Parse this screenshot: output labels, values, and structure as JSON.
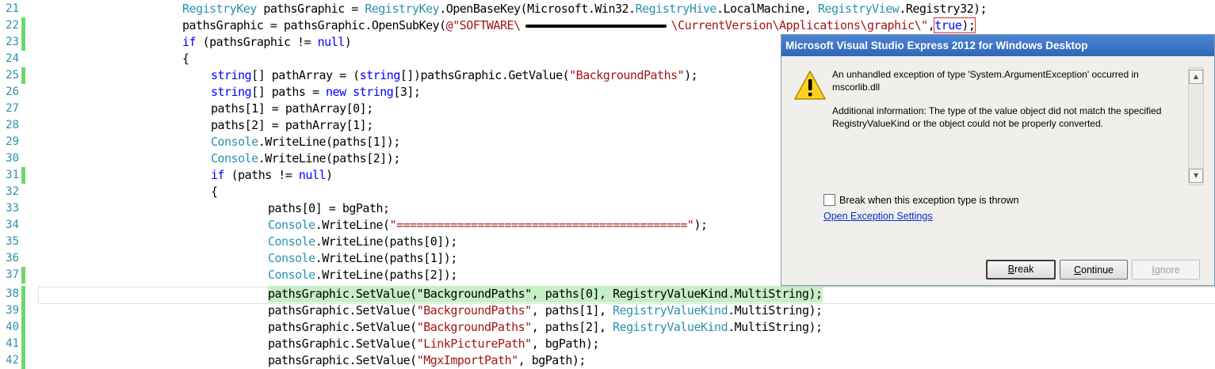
{
  "editor": {
    "lines": [
      {
        "num": "21",
        "modified": false
      },
      {
        "num": "22",
        "modified": true
      },
      {
        "num": "23",
        "modified": true
      },
      {
        "num": "24",
        "modified": false
      },
      {
        "num": "25",
        "modified": true
      },
      {
        "num": "26",
        "modified": false
      },
      {
        "num": "27",
        "modified": false
      },
      {
        "num": "28",
        "modified": false
      },
      {
        "num": "29",
        "modified": false
      },
      {
        "num": "30",
        "modified": false
      },
      {
        "num": "31",
        "modified": true
      },
      {
        "num": "32",
        "modified": false
      },
      {
        "num": "33",
        "modified": false
      },
      {
        "num": "34",
        "modified": false
      },
      {
        "num": "35",
        "modified": false
      },
      {
        "num": "36",
        "modified": false
      },
      {
        "num": "37",
        "modified": true
      },
      {
        "num": "38",
        "modified": true
      },
      {
        "num": "39",
        "modified": true
      },
      {
        "num": "40",
        "modified": true
      },
      {
        "num": "41",
        "modified": true
      },
      {
        "num": "42",
        "modified": true
      }
    ],
    "tokens": {
      "t21a": "RegistryKey",
      "t21b": " pathsGraphic = ",
      "t21c": "RegistryKey",
      "t21d": ".OpenBaseKey(Microsoft.Win32.",
      "t21e": "RegistryHive",
      "t21f": ".LocalMachine, ",
      "t21g": "RegistryView",
      "t21h": ".Registry32);",
      "t22a": "pathsGraphic = pathsGraphic.OpenSubKey(",
      "t22b": "@\"SOFTWARE\\",
      "t22c": "\\CurrentVersion\\Applications\\graphic\\\"",
      "t22d": ",",
      "t22e": "true",
      "t22f": ");",
      "t23a": "if",
      "t23b": " (pathsGraphic != ",
      "t23c": "null",
      "t23d": ")",
      "t24": "{",
      "t25a": "string",
      "t25b": "[] pathArray = (",
      "t25c": "string",
      "t25d": "[])pathsGraphic.GetValue(",
      "t25e": "\"BackgroundPaths\"",
      "t25f": ");",
      "t26a": "string",
      "t26b": "[] paths = ",
      "t26c": "new",
      "t26d": " ",
      "t26e": "string",
      "t26f": "[3];",
      "t27": "paths[1] = pathArray[0];",
      "t28": "paths[2] = pathArray[1];",
      "t29a": "Console",
      "t29b": ".WriteLine(paths[1]);",
      "t30a": "Console",
      "t30b": ".WriteLine(paths[2]);",
      "t31a": "if",
      "t31b": " (paths != ",
      "t31c": "null",
      "t31d": ")",
      "t32": "{",
      "t33": "paths[0] = bgPath;",
      "t34a": "Console",
      "t34b": ".WriteLine(",
      "t34c": "\"===========================================\"",
      "t34d": ");",
      "t35a": "Console",
      "t35b": ".WriteLine(paths[0]);",
      "t36a": "Console",
      "t36b": ".WriteLine(paths[1]);",
      "t37a": "Console",
      "t37b": ".WriteLine(paths[2]);",
      "t38": "pathsGraphic.SetValue(\"BackgroundPaths\", paths[0], RegistryValueKind.MultiString);",
      "t39a": "pathsGraphic.SetValue(",
      "t39b": "\"BackgroundPaths\"",
      "t39c": ", paths[1], ",
      "t39d": "RegistryValueKind",
      "t39e": ".MultiString);",
      "t40a": "pathsGraphic.SetValue(",
      "t40b": "\"BackgroundPaths\"",
      "t40c": ", paths[2], ",
      "t40d": "RegistryValueKind",
      "t40e": ".MultiString);",
      "t41a": "pathsGraphic.SetValue(",
      "t41b": "\"LinkPicturePath\"",
      "t41c": ", bgPath);",
      "t42a": "pathsGraphic.SetValue(",
      "t42b": "\"MgxImportPath\"",
      "t42c": ", bgPath);"
    }
  },
  "dialog": {
    "title": "Microsoft Visual Studio Express 2012 for Windows Desktop",
    "message": "An unhandled exception of type 'System.ArgumentException' occurred in mscorlib.dll",
    "additional": "Additional information: The type of the value object did not match the specified RegistryValueKind or the object could not be properly converted.",
    "checkbox_label": "Break when this exception type is thrown",
    "checkbox_checked": false,
    "link_label": "Open Exception Settings",
    "buttons": {
      "break_key": "B",
      "break_rest": "reak",
      "continue_key": "C",
      "continue_rest": "ontinue",
      "ignore_key": "I",
      "ignore_rest": "gnore"
    },
    "icon": "warning-icon"
  },
  "colors": {
    "keyword": "#0000ff",
    "type": "#2b91af",
    "string": "#a31515",
    "change_marker": "#6cd76c",
    "statement_highlight": "#c6efc6",
    "titlebar": "#3a70c2"
  }
}
